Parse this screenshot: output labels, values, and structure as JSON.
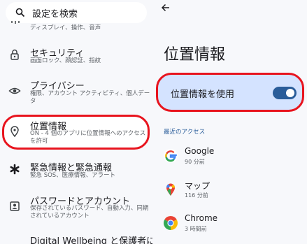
{
  "search": {
    "placeholder": "設定を検索",
    "icon": "search-icon"
  },
  "left_list": {
    "partial_top": {
      "sub": "ディスプレイ、操作、音声"
    },
    "items": [
      {
        "title": "セキュリティ",
        "sub": "画面ロック、顔認証、指紋",
        "icon": "lock-icon"
      },
      {
        "title": "プライバシー",
        "sub": "権限、アカウント アクティビティ、個人データ",
        "icon": "privacy-eye-icon"
      },
      {
        "title": "位置情報",
        "sub": "ON - 4 個のアプリに位置情報へのアクセスを許可",
        "icon": "location-pin-icon"
      },
      {
        "title": "緊急情報と緊急通報",
        "sub": "緊急 SOS、医療情報、アラート",
        "icon": "emergency-asterisk-icon"
      },
      {
        "title": "パスワードとアカウント",
        "sub": "保存されているパスワード、自動入力、同期されているアカウント",
        "icon": "account-card-icon"
      },
      {
        "title": "Digital Wellbeing と保護者に",
        "sub": "",
        "icon": ""
      }
    ]
  },
  "detail": {
    "back_icon": "back-arrow-icon",
    "title": "位置情報",
    "toggle": {
      "label": "位置情報を使用",
      "on": true,
      "color": "#2a5d9a"
    },
    "recent_header": "最近のアクセス",
    "recent": [
      {
        "name": "Google",
        "time": "90 分前",
        "icon": "google-icon"
      },
      {
        "name": "マップ",
        "time": "116 分前",
        "icon": "maps-icon"
      },
      {
        "name": "Chrome",
        "time": "3 時間前",
        "icon": "chrome-icon"
      }
    ]
  },
  "colors": {
    "highlight": "#e8141e",
    "accent": "#2a5d9a",
    "card": "#d4e3ff"
  }
}
